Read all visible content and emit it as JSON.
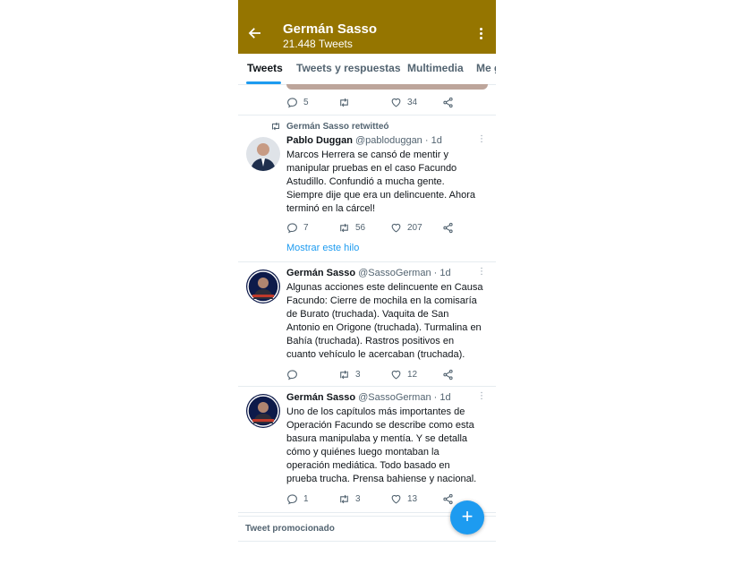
{
  "header": {
    "title": "Germán Sasso",
    "subtitle": "21.448 Tweets",
    "color": "#957500"
  },
  "tabs": [
    "Tweets",
    "Tweets y respuestas",
    "Multimedia",
    "Me g"
  ],
  "top_actions": {
    "replies": "5",
    "retweets": "",
    "likes": "34"
  },
  "tweets": [
    {
      "retweeted_by": "Germán Sasso retwitteó",
      "name": "Pablo Duggan",
      "handle": "@pabloduggan",
      "time": "· 1d",
      "lines": [
        "Marcos Herrera se cansó de mentir y",
        "manipular pruebas en el caso Facundo",
        "Astudillo. Confundió a mucha gente.",
        "Siempre dije que era un delincuente. Ahora",
        "terminó en la cárcel!"
      ],
      "replies": "7",
      "retweets": "56",
      "likes": "207",
      "thread_link": "Mostrar este hilo"
    },
    {
      "name": "Germán Sasso",
      "handle": "@SassoGerman",
      "time": "· 1d",
      "lines": [
        "Algunas acciones este delincuente en Causa",
        "Facundo: Cierre de mochila en la comisaría",
        "de Burato (truchada). Vaquita de San",
        "Antonio en Origone (truchada). Turmalina en",
        "Bahía (truchada). Rastros positivos en",
        "cuanto vehículo le acercaban (truchada)."
      ],
      "replies": "",
      "retweets": "3",
      "likes": "12"
    },
    {
      "name": "Germán Sasso",
      "handle": "@SassoGerman",
      "time": "· 1d",
      "lines": [
        "Uno de los capítulos más importantes de",
        "Operación Facundo se describe como esta",
        "basura manipulaba y mentía. Y se detalla",
        "cómo y quiénes luego montaban la",
        "operación mediática. Todo basado en",
        "prueba trucha. Prensa bahiense y nacional."
      ],
      "replies": "1",
      "retweets": "3",
      "likes": "13"
    }
  ],
  "promoted_label": "Tweet promocionado",
  "fab_label": "+",
  "accent": "#1d9bf0"
}
